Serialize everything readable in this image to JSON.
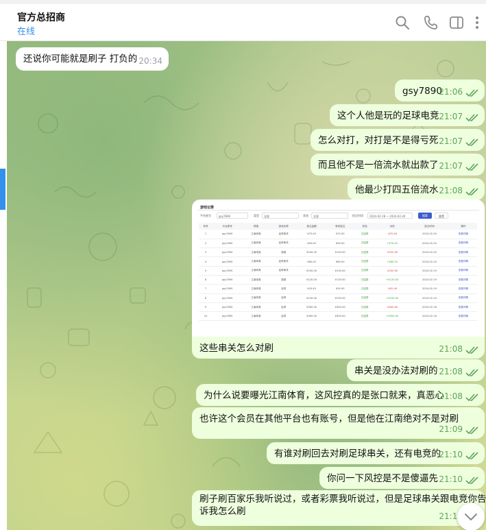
{
  "header": {
    "name": "官方总招商",
    "status": "在线"
  },
  "icons": {
    "search": "search-icon",
    "call": "phone-icon",
    "sidebar": "sidebar-toggle-icon",
    "more": "more-vertical-icon"
  },
  "messages": [
    {
      "text": "还说你可能就是刷子 打负的",
      "time": "20:34"
    },
    {
      "text": "gsy7890",
      "time": "21:06"
    },
    {
      "text": "这个人他是玩的足球电竞",
      "time": "21:07"
    },
    {
      "text": "怎么对打，对打是不是得亏死",
      "time": "21:07"
    },
    {
      "text": "而且他不是一倍流水就出款了",
      "time": "21:07"
    },
    {
      "text": "他最少打四五倍流水",
      "time": "21:08"
    },
    {
      "text": "这些串关怎么对刷",
      "time": "21:08"
    },
    {
      "text": "串关是没办法对刷的",
      "time": "21:08"
    },
    {
      "text": "为什么说要曝光江南体育，这风控真的是张口就来，真恶心",
      "time": "21:08"
    },
    {
      "text": "也许这个会员在其他平台也有账号，但是他在江南绝对不是对刷",
      "time": "21:09"
    },
    {
      "text": "有谁对刷回去对刷足球串关，还有电竞的",
      "time": "21:10"
    },
    {
      "text": "你问一下风控是不是傻逼先",
      "time": "21:10"
    },
    {
      "text_line1": "刷子刷百家乐我听说过，或者彩票我听说过，但是足球串关跟电竞你告",
      "text_line2": "诉我怎么刷",
      "time": "21:11"
    }
  ],
  "photo": {
    "title": "游戏记录",
    "filters": {
      "account_label": "平台账号",
      "account_value": "gsy7890",
      "type_label": "类型",
      "type_value": "全部",
      "status_label": "状态",
      "status_value": "全部",
      "date_label": "投注时间",
      "date_start": "2024-02-18",
      "date_end": "2024-02-20",
      "search_button": "搜索",
      "reset_button": "重置"
    },
    "columns": [
      "序号",
      "平台账号",
      "场馆",
      "游戏名称",
      "投注金额",
      "有效投注",
      "状态",
      "派彩",
      "投注时间",
      "操作"
    ],
    "rows": [
      {
        "account": "gsy7890",
        "venue": "江南体育",
        "game": "足球串关",
        "bet": "¥70.00",
        "valid": "¥70.00",
        "status": "已结算",
        "payout": "-¥70.00",
        "date": "2024-02-20",
        "action": "查看详情"
      },
      {
        "account": "gsy7890",
        "venue": "江南体育",
        "game": "足球串关",
        "bet": "¥90.00",
        "valid": "¥90.00",
        "status": "已结算",
        "payout": "+¥70.00",
        "date": "2024-02-20",
        "action": "查看详情"
      },
      {
        "account": "gsy7890",
        "venue": "江南电竞",
        "game": "英雄",
        "bet": "¥200.00",
        "valid": "¥150.00",
        "status": "已结算",
        "payout": "-¥150.00",
        "date": "2024-02-20",
        "action": "查看详情"
      },
      {
        "account": "gsy7890",
        "venue": "江南体育",
        "game": "足球串关",
        "bet": "¥80.00",
        "valid": "¥80.00",
        "status": "已结算",
        "payout": "+¥80.00",
        "date": "2024-02-20",
        "action": "查看详情"
      },
      {
        "account": "gsy7890",
        "venue": "江南体育",
        "game": "足球串关",
        "bet": "¥100.00",
        "valid": "¥100.00",
        "status": "已结算",
        "payout": "-¥100.00",
        "date": "2024-02-19",
        "action": "查看详情"
      },
      {
        "account": "gsy7890",
        "venue": "江南电竞",
        "game": "英雄",
        "bet": "¥120.00",
        "valid": "¥120.00",
        "status": "已结算",
        "payout": "+¥120.00",
        "date": "2024-02-19",
        "action": "查看详情"
      },
      {
        "account": "gsy7890",
        "venue": "江南体育",
        "game": "足球",
        "bet": "¥20.40",
        "valid": "¥20.40",
        "status": "已结算",
        "payout": "-¥20.40",
        "date": "2024-02-19",
        "action": "查看详情"
      },
      {
        "account": "gsy7890",
        "venue": "江南体育",
        "game": "足球",
        "bet": "¥150.00",
        "valid": "¥150.00",
        "status": "已结算",
        "payout": "+¥150.00",
        "date": "2024-02-19",
        "action": "查看详情"
      },
      {
        "account": "gsy7890",
        "venue": "江南体育",
        "game": "足球",
        "bet": "¥300.00",
        "valid": "¥300.00",
        "status": "已结算",
        "payout": "-¥300.00",
        "date": "2024-02-18",
        "action": "查看详情"
      },
      {
        "account": "gsy7890",
        "venue": "江南体育",
        "game": "足球",
        "bet": "¥300.00",
        "valid": "¥300.00",
        "status": "已结算",
        "payout": "+¥300.00",
        "date": "2024-02-18",
        "action": "查看详情"
      }
    ]
  },
  "colors": {
    "accent": "#3390ec",
    "outgoing_bubble": "#eeffde",
    "incoming_bubble": "#ffffff",
    "time_out": "#5da35a"
  }
}
